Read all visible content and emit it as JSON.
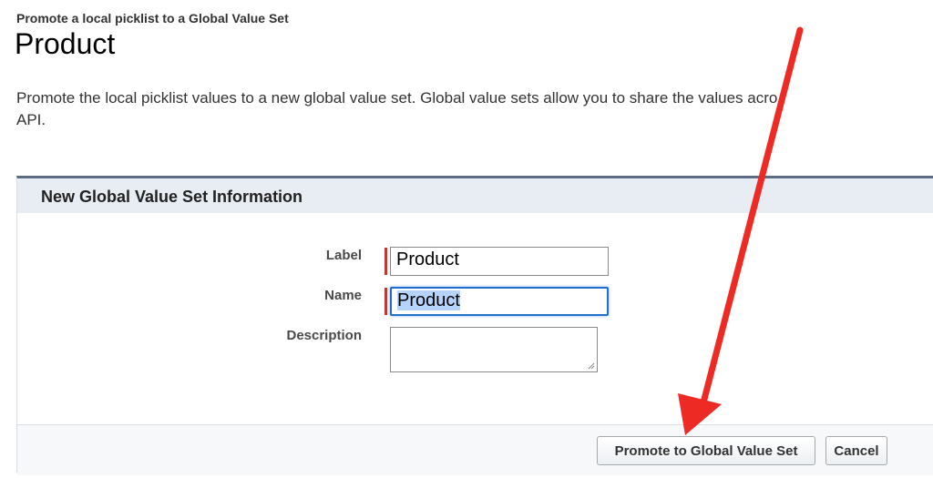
{
  "breadcrumb": "Promote a local picklist to a Global Value Set",
  "page_title": "Product",
  "intro_text": "Promote the local picklist values to a new global value set. Global value sets allow you to share the values acro",
  "intro_text_line2": "API.",
  "panel": {
    "header_title": "New Global Value Set Information",
    "fields": {
      "label": {
        "label": "Label",
        "value": "Product",
        "required": true
      },
      "name": {
        "label": "Name",
        "value": "Product",
        "required": true,
        "selected": true
      },
      "description": {
        "label": "Description",
        "value": ""
      }
    }
  },
  "buttons": {
    "promote": "Promote to Global Value Set",
    "cancel": "Cancel"
  },
  "colors": {
    "required_marker": "#c23934",
    "focus_border": "#1f6fd0",
    "annotation_arrow": "#ee2a24"
  },
  "annotation": {
    "type": "arrow",
    "points_to": "Promote to Global Value Set"
  }
}
